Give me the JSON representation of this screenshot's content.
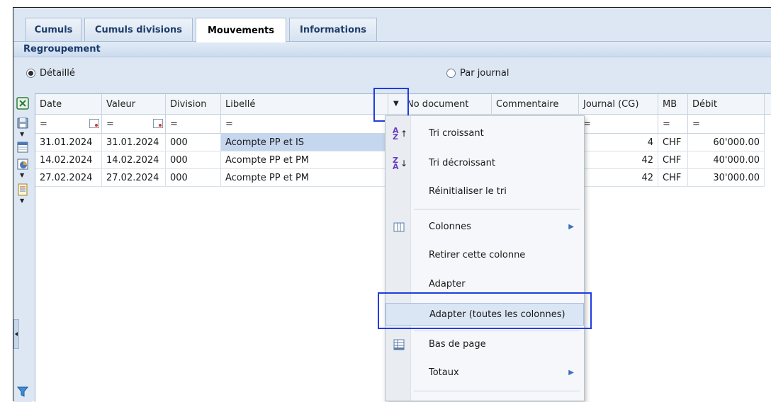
{
  "tabs": [
    {
      "label": "Cumuls"
    },
    {
      "label": "Cumuls divisions"
    },
    {
      "label": "Mouvements",
      "active": true
    },
    {
      "label": "Informations"
    }
  ],
  "section": {
    "title": "Regroupement"
  },
  "grouping": {
    "detail_label": "Détaillé",
    "journal_label": "Par journal",
    "selected": "detail"
  },
  "columns": [
    {
      "label": "Date"
    },
    {
      "label": "Valeur"
    },
    {
      "label": "Division"
    },
    {
      "label": "Libellé"
    },
    {
      "label": "No document"
    },
    {
      "label": "Commentaire"
    },
    {
      "label": "Journal (CG)"
    },
    {
      "label": "MB"
    },
    {
      "label": "Débit"
    }
  ],
  "filter_symbol": "=",
  "rows": [
    {
      "date": "31.01.2024",
      "valeur": "31.01.2024",
      "division": "000",
      "libelle": "Acompte PP et IS",
      "journal": "4",
      "mb": "CHF",
      "debit": "60'000.00",
      "selected": true
    },
    {
      "date": "14.02.2024",
      "valeur": "14.02.2024",
      "division": "000",
      "libelle": "Acompte PP et PM",
      "journal": "42",
      "mb": "CHF",
      "debit": "40'000.00"
    },
    {
      "date": "27.02.2024",
      "valeur": "27.02.2024",
      "division": "000",
      "libelle": "Acompte PP et PM",
      "journal": "42",
      "mb": "CHF",
      "debit": "30'000.00"
    }
  ],
  "menu": {
    "sort_asc": "Tri croissant",
    "sort_desc": "Tri décroissant",
    "reset_sort": "Réinitialiser le tri",
    "columns": "Colonnes",
    "remove_column": "Retirer cette colonne",
    "fit": "Adapter",
    "fit_all": "Adapter (toutes les colonnes)",
    "footer": "Bas de page",
    "totals": "Totaux"
  },
  "colors": {
    "highlight": "#1f3de0",
    "selected_row": "#c5d7ee",
    "panel_bg": "#dde7f3"
  }
}
